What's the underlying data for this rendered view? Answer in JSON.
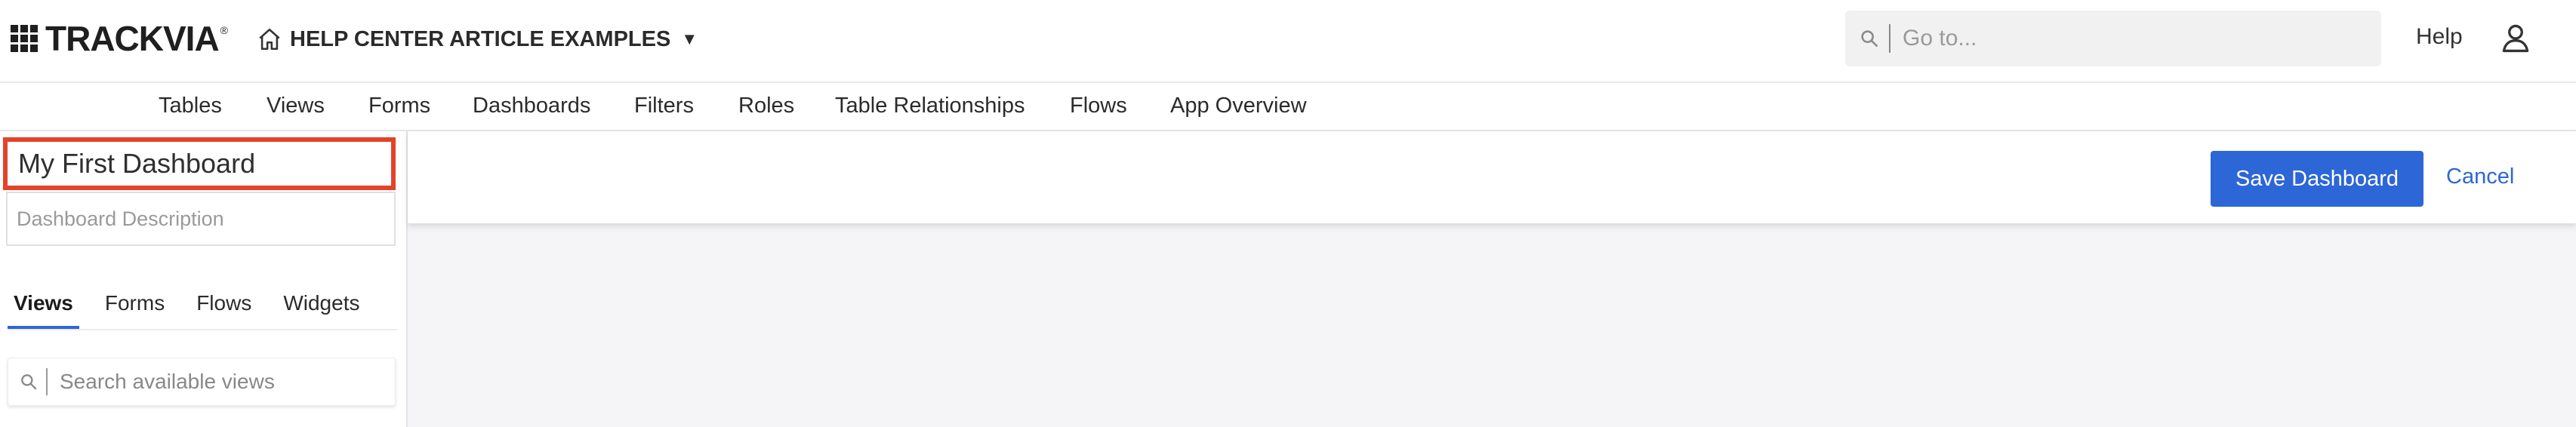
{
  "header": {
    "logo_text": "TRACKVIA",
    "logo_mark": "®",
    "app_name": "HELP CENTER ARTICLE EXAMPLES",
    "app_caret": "▼",
    "goto_placeholder": "Go to...",
    "help_label": "Help",
    "icons": {
      "home": "home-icon",
      "search": "search-icon",
      "user": "user-icon"
    }
  },
  "subnav": {
    "items": [
      "Tables",
      "Views",
      "Forms",
      "Dashboards",
      "Filters",
      "Roles",
      "Table Relationships",
      "Flows",
      "App Overview"
    ]
  },
  "dashboard": {
    "title": "My First Dashboard",
    "description_placeholder": "Dashboard Description",
    "title_highlight_color": "#e2432a"
  },
  "panel": {
    "tabs": [
      "Views",
      "Forms",
      "Flows",
      "Widgets"
    ],
    "active_tab": "Views",
    "search_placeholder": "Search available views"
  },
  "toolbar": {
    "save_label": "Save Dashboard",
    "cancel_label": "Cancel"
  },
  "colors": {
    "accent": "#2d66d6",
    "highlight": "#e2432a",
    "canvas_bg": "#f5f5f7"
  }
}
